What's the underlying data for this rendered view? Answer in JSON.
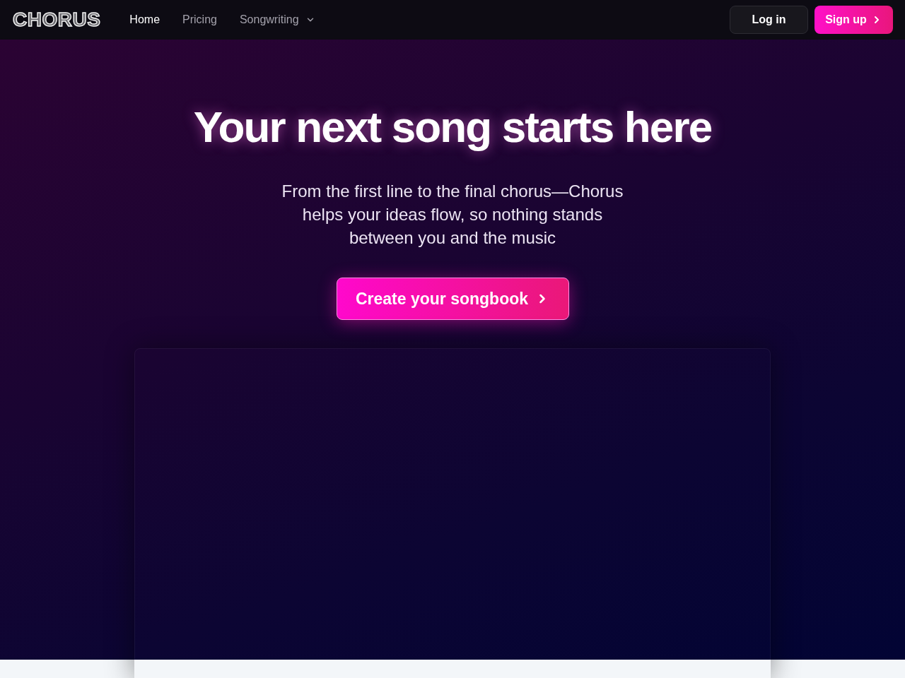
{
  "nav": {
    "logo": "CHORUS",
    "links": [
      {
        "label": "Home",
        "selected": true,
        "kind": "link"
      },
      {
        "label": "Pricing",
        "selected": false,
        "kind": "link"
      },
      {
        "label": "Songwriting",
        "selected": false,
        "kind": "dropdown"
      }
    ],
    "actions": [
      {
        "label": "Log in",
        "kind": "secondary"
      },
      {
        "label": "Sign up",
        "kind": "primary"
      }
    ]
  },
  "hero": {
    "title": "Your next song starts here",
    "subtitle": "From the first line to the final chorus—Chorus helps your ideas flow, so nothing stands between you and the music",
    "cta": "Create your songbook"
  }
}
